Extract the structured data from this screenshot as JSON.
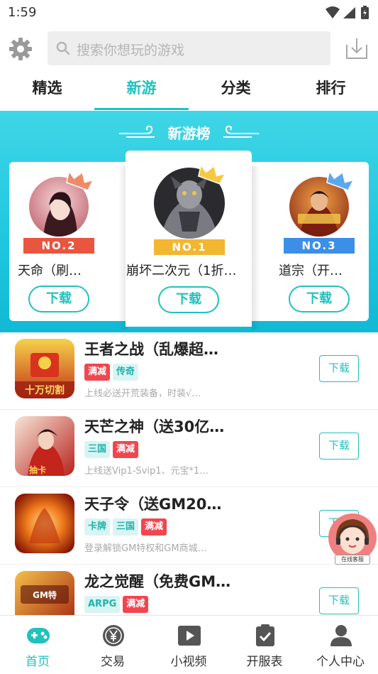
{
  "status_bar": {
    "time": "1:59"
  },
  "header": {
    "search_placeholder": "搜索你想玩的游戏"
  },
  "tabs": [
    {
      "label": "精选",
      "active": false
    },
    {
      "label": "新游",
      "active": true
    },
    {
      "label": "分类",
      "active": false
    },
    {
      "label": "排行",
      "active": false
    }
  ],
  "banner": {
    "title": "新游榜",
    "ranks": [
      {
        "badge": "NO.1",
        "name": "崩坏二次元（1折…",
        "download_label": "下载"
      },
      {
        "badge": "NO.2",
        "name": "天命（刷…",
        "download_label": "下载"
      },
      {
        "badge": "NO.3",
        "name": "道宗（开…",
        "download_label": "下载"
      }
    ]
  },
  "games": [
    {
      "title": "王者之战（乱爆超…",
      "tags": [
        "满减",
        "传奇"
      ],
      "description": "上线必送开荒装备，时装√…",
      "download_label": "下载",
      "icon_text": "十万切割"
    },
    {
      "title": "天芒之神（送30亿…",
      "tags": [
        "三国",
        "满减"
      ],
      "description": "上线送Vip1-Svip1、元宝*1…",
      "download_label": "下载",
      "icon_text": "抽卡"
    },
    {
      "title": "天子令（送GM20…",
      "tags": [
        "卡牌",
        "三国",
        "满减"
      ],
      "description": "登录解锁GM特权和GM商城…",
      "download_label": "下载",
      "icon_text": ""
    },
    {
      "title": "龙之觉醒（免费GM…",
      "tags": [
        "ARPG",
        "满减"
      ],
      "description": "",
      "download_label": "下载",
      "icon_text": "GM特"
    }
  ],
  "support": {
    "label": "在线客服"
  },
  "bottom_nav": [
    {
      "label": "首页",
      "icon": "gamepad-icon",
      "active": true
    },
    {
      "label": "交易",
      "icon": "yen-coin-icon",
      "active": false
    },
    {
      "label": "小视频",
      "icon": "play-video-icon",
      "active": false
    },
    {
      "label": "开服表",
      "icon": "clipboard-check-icon",
      "active": false
    },
    {
      "label": "个人中心",
      "icon": "person-icon",
      "active": false
    }
  ],
  "colors": {
    "accent": "#20c2bd",
    "tag_red": "#f0474f",
    "banner": "#1fc6df"
  }
}
